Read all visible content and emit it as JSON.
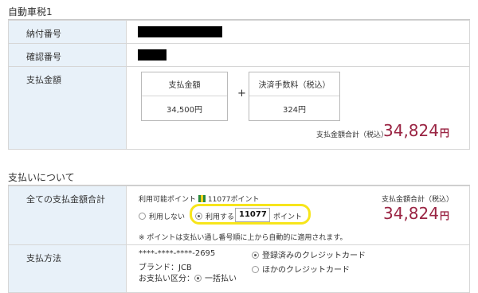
{
  "section1": {
    "title": "自動車税1",
    "rows": {
      "nofu_label": "納付番号",
      "kakunin_label": "確認番号",
      "amount_label": "支払金額"
    },
    "fees": {
      "payment_label": "支払金額",
      "payment_value": "34,500円",
      "plus": "+",
      "fee_label": "決済手数料（税込）",
      "fee_value": "324円"
    },
    "total_label": "支払金額合計（税込）",
    "total_number": "34,824",
    "total_yen": "円"
  },
  "section2": {
    "title": "支払いについて",
    "all_total_label": "全ての支払金額合計",
    "points_available_label": "利用可能ポイント",
    "points_available_value": "11077ポイント",
    "option_no": "利用しない",
    "option_yes": "利用する",
    "points_input_value": "11077",
    "points_unit": "ポイント",
    "points_note": "※ ポイントは支払い通し番号順に上から自動的に適用されます。",
    "total_label": "支払金額合計（税込）",
    "total_number": "34,824",
    "total_yen": "円",
    "method_label": "支払方法",
    "card_number": "****-****-****-2695",
    "brand": "ブランド：JCB",
    "installment_label": "お支払い区分：",
    "installment_value": "一括払い",
    "card_option_registered": "登録済みのクレジットカード",
    "card_option_other": "ほかのクレジットカード"
  }
}
